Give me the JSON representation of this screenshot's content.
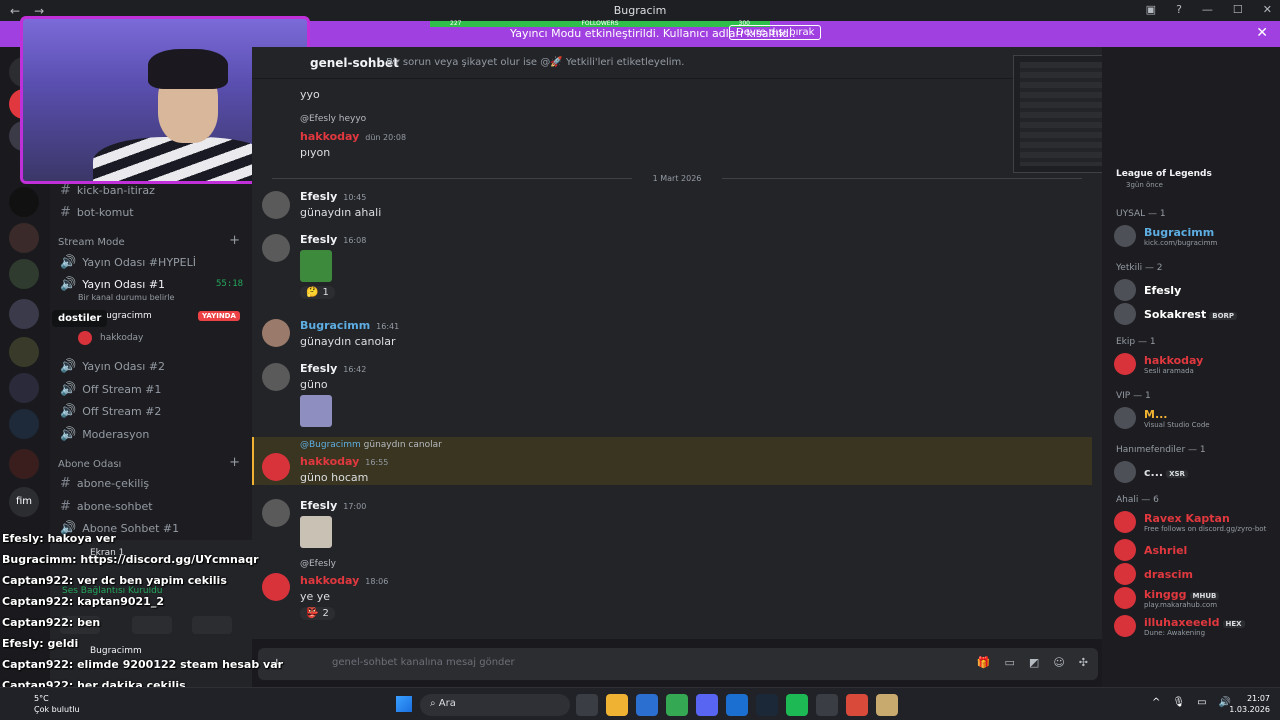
{
  "window": {
    "title": "Bugracim",
    "followers_label": "FOLLOWERS",
    "followers_left": "227",
    "followers_right": "300"
  },
  "banner": {
    "message": "Yayıncı Modu etkinleştirildi. Kullanıcı adları kısaltıldı.",
    "button": "Devre dışı bırak"
  },
  "channel": {
    "name": "genel-sohbet",
    "topic": "Bir sorun veya şikayet olur ise @🚀 Yetkili'leri etiketleyelim."
  },
  "tooltip": "dostiler",
  "sidebar": {
    "channels_top": [
      "kick-ban-itiraz",
      "bot-komut"
    ],
    "stream_mode_label": "Stream Mode",
    "voice_channels": [
      "Yayın Odası #HYPELİ",
      "Yayın Odası #1",
      "Yayın Odası #2",
      "Off Stream #1",
      "Off Stream #2",
      "Moderasyon"
    ],
    "stream_room_time": "55:18",
    "stream_room_status": "Bir kanal durumu belirle",
    "voice_user1": "Bugracimm",
    "voice_user1_badge": "YAYINDA",
    "voice_user2": "hakkoday",
    "abone_label": "Abone Odası",
    "abone_channels": [
      "abone-çekiliş",
      "abone-sohbet",
      "Abone Sohbet #1"
    ],
    "voice_panel": {
      "screen": "Ekran 1",
      "connected": "Ses Bağlantısı Kuruldu",
      "user": "Bugracimm"
    },
    "server_label": "fim"
  },
  "messages": {
    "m0": {
      "text": "yyo"
    },
    "m1_reply": "@Efesly heyyo",
    "m1": {
      "name": "hakkoday",
      "time": "dün 20:08",
      "text": "pıyon"
    },
    "divider": "1 Mart 2026",
    "m2": {
      "name": "Efesly",
      "time": "10:45",
      "text": "günaydın ahali"
    },
    "m3": {
      "name": "Efesly",
      "time": "16:08",
      "react_count": "1"
    },
    "m4": {
      "name": "Bugracimm",
      "time": "16:41",
      "text": "günaydın canolar"
    },
    "m5": {
      "name": "Efesly",
      "time": "16:42",
      "text": "güno"
    },
    "m6_reply_user": "@Bugracimm",
    "m6_reply_text": "günaydın canolar",
    "m6": {
      "name": "hakkoday",
      "time": "16:55",
      "text": "güno hocam"
    },
    "m7": {
      "name": "Efesly",
      "time": "17:00"
    },
    "m8_reply": "@Efesly",
    "m8": {
      "name": "hakkoday",
      "time": "18:06",
      "text": "ye ye",
      "react_count": "2"
    }
  },
  "composer": {
    "placeholder": "genel-sohbet kanalına mesaj gönder"
  },
  "members": {
    "game": {
      "title": "League of Legends",
      "sub": "3gün önce"
    },
    "groups": [
      {
        "label": "UYSAL — 1",
        "items": [
          {
            "name": "Bugracimm",
            "sub": "kick.com/bugracimm",
            "color": "#5dade2"
          }
        ]
      },
      {
        "label": "Yetkili — 2",
        "items": [
          {
            "name": "Efesly",
            "sub": "",
            "color": "#ffffff"
          },
          {
            "name": "Sokakrest",
            "sub": "BORP",
            "tag": "BORP",
            "color": "#ffffff"
          }
        ]
      },
      {
        "label": "Ekip — 1",
        "items": [
          {
            "name": "hakkoday",
            "sub": "Sesli aramada",
            "color": "#e0383e"
          }
        ]
      },
      {
        "label": "VIP — 1",
        "items": [
          {
            "name": "M...",
            "sub": "Visual Studio Code",
            "color": "#f0b232"
          }
        ]
      },
      {
        "label": "Hanımefendiler — 1",
        "items": [
          {
            "name": "c...",
            "sub": "",
            "tag": "XSR",
            "color": "#dbdee1"
          }
        ]
      },
      {
        "label": "Ahali — 6",
        "items": [
          {
            "name": "Ravex Kaptan",
            "sub": "Free follows on discord.gg/zyro-bot",
            "color": "#e0383e"
          },
          {
            "name": "Ashriel",
            "sub": "",
            "color": "#e0383e"
          },
          {
            "name": "drascim",
            "sub": "",
            "color": "#e0383e"
          },
          {
            "name": "kinggg",
            "sub": "play.makarahub.com",
            "tag": "MHUB",
            "color": "#e0383e"
          },
          {
            "name": "illuhaxeeeld",
            "sub": "Dune: Awakening",
            "tag": "HEX",
            "color": "#e0383e"
          }
        ]
      }
    ]
  },
  "overlay_chat": [
    {
      "user": "Efesly",
      "text": "hakoya ver"
    },
    {
      "user": "Bugracimm",
      "text": "https://discord.gg/UYcmnaqr"
    },
    {
      "user": "Captan922",
      "text": "ver dc ben yapim cekilis"
    },
    {
      "user": "Captan922",
      "text": "kaptan9021_2"
    },
    {
      "user": "Captan922",
      "text": "ben"
    },
    {
      "user": "Efesly",
      "text": "geldi"
    },
    {
      "user": "Captan922",
      "text": "elimde 9200122 steam hesab var"
    },
    {
      "user": "Captan922",
      "text": "her dakika cekilis"
    }
  ],
  "taskbar": {
    "temp": "5°C",
    "weather": "Çok bulutlu",
    "search": "Ara",
    "time": "21:07",
    "date": "1.03.2026"
  },
  "colors": {
    "accent": "#a140e0",
    "discord_red": "#d8323b",
    "live": "#ed4245"
  }
}
